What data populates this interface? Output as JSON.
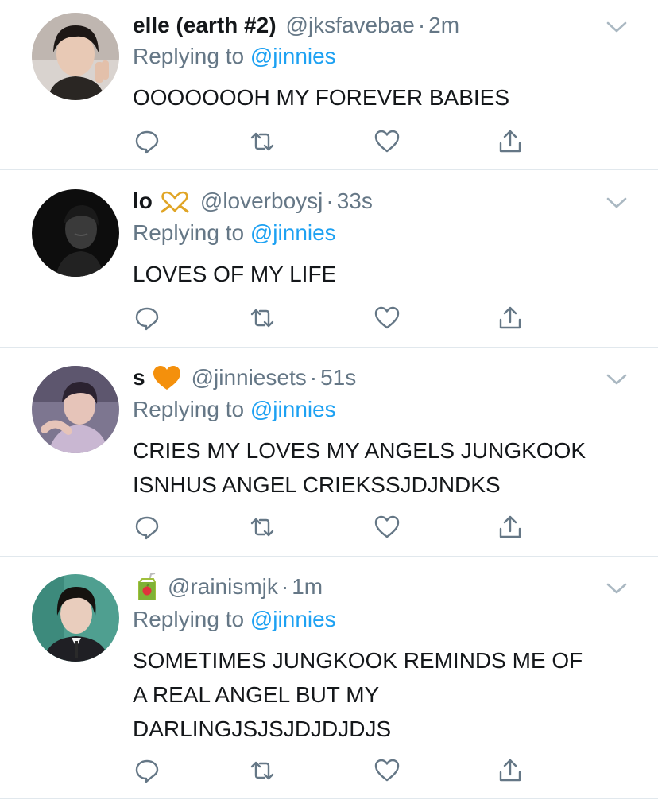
{
  "tweets": [
    {
      "name": "elle (earth #2)",
      "emoji": "",
      "handle": "@jksfavebae",
      "time": "2m",
      "replying_prefix": "Replying to",
      "replying_to": "@jinnies",
      "text_lines": [
        "OOOOOOOH MY FOREVER BABIES"
      ]
    },
    {
      "name": "lo",
      "emoji": "heart-hands-icon",
      "handle": "@loverboysj",
      "time": "33s",
      "replying_prefix": "Replying to",
      "replying_to": "@jinnies",
      "text_lines": [
        "LOVES OF MY LIFE"
      ]
    },
    {
      "name": "s",
      "emoji": "orange-heart-icon",
      "handle": "@jinniesets",
      "time": "51s",
      "replying_prefix": "Replying to",
      "replying_to": "@jinnies",
      "text_lines": [
        "CRIES MY LOVES MY ANGELS JUNGKOOK",
        "ISNHUS ANGEL CRIEKSSJDJNDKS"
      ]
    },
    {
      "name": "",
      "emoji": "juice-box-icon",
      "handle": "@rainismjk",
      "time": "1m",
      "replying_prefix": "Replying to",
      "replying_to": "@jinnies",
      "text_lines": [
        "SOMETIMES JUNGKOOK REMINDS ME OF",
        "A REAL ANGEL BUT MY",
        "DARLINGJSJSJDJDJDJS"
      ]
    }
  ],
  "separator": "·",
  "colors": {
    "link": "#1da1f2",
    "secondary_text": "#657786",
    "primary_text": "#14171a",
    "divider": "#e1e8ed",
    "orange_heart": "#f4900c"
  }
}
